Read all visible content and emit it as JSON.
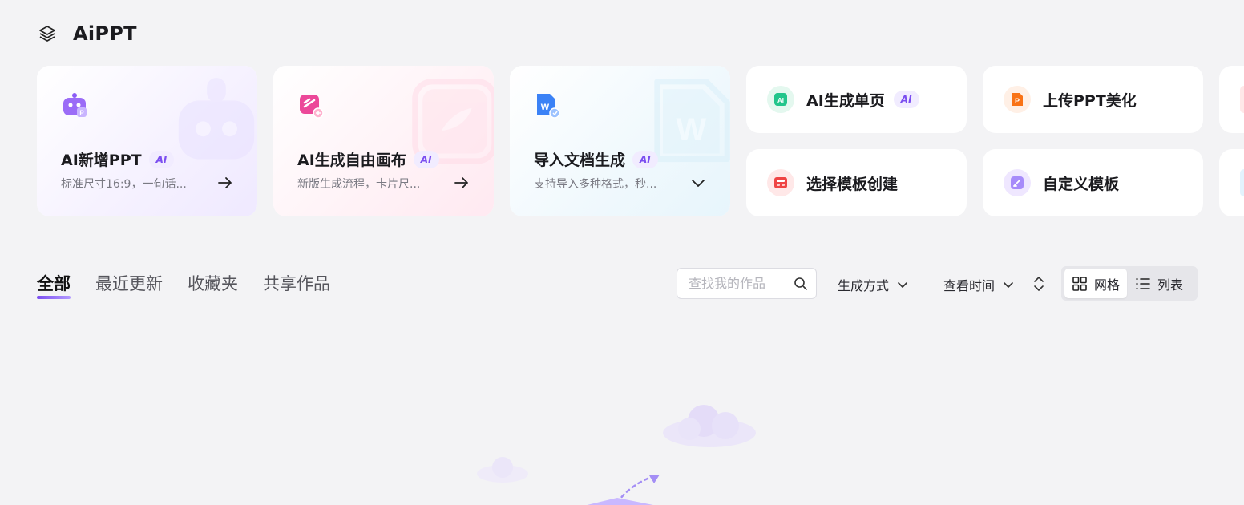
{
  "app": {
    "title": "AiPPT",
    "logo_icon": "layers-icon"
  },
  "big_cards": [
    {
      "title": "AI新增PPT",
      "badge": "AI",
      "desc": "标准尺寸16:9，一句话...",
      "icon": "robot-icon",
      "action_icon": "arrow-right-icon",
      "accent": "#8b5cf6"
    },
    {
      "title": "AI生成自由画布",
      "badge": "AI",
      "desc": "新版生成流程，卡片尺...",
      "icon": "canvas-icon",
      "action_icon": "arrow-right-icon",
      "accent": "#ec4899"
    },
    {
      "title": "导入文档生成",
      "badge": "AI",
      "desc": "支持导入多种格式，秒...",
      "icon": "word-doc-icon",
      "action_icon": "chevron-down-icon",
      "accent": "#3b82f6"
    }
  ],
  "small_cards": [
    {
      "title": "AI生成单页",
      "badge": "AI",
      "icon": "ai-page-icon",
      "color": "#22c58b"
    },
    {
      "title": "上传PPT美化",
      "icon": "ppt-file-icon",
      "color": "#f97316"
    },
    {
      "title": "选择模板创建",
      "icon": "template-icon",
      "color": "#ef4444"
    },
    {
      "title": "自定义模板",
      "icon": "edit-template-icon",
      "color": "#8b5cf6"
    }
  ],
  "tabs": [
    {
      "label": "全部",
      "active": true
    },
    {
      "label": "最近更新",
      "active": false
    },
    {
      "label": "收藏夹",
      "active": false
    },
    {
      "label": "共享作品",
      "active": false
    }
  ],
  "search": {
    "placeholder": "查找我的作品",
    "value": ""
  },
  "filters": {
    "method": "生成方式",
    "time": "查看时间"
  },
  "view_toggle": {
    "grid": "网格",
    "list": "列表",
    "selected": "grid"
  }
}
